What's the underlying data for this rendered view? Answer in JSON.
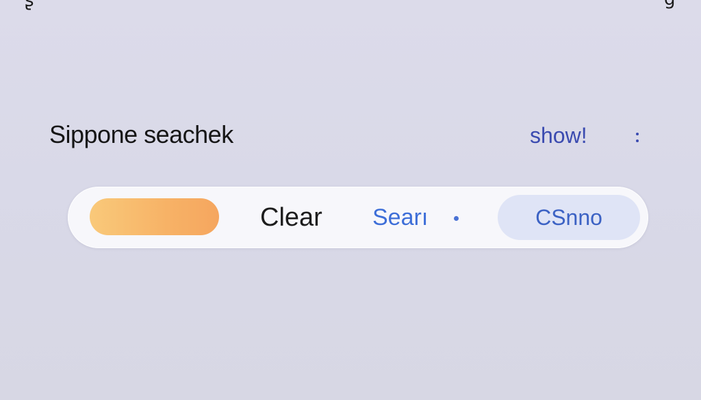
{
  "header": {
    "title": "Sippone seachek",
    "show_link": "show!",
    "more_icon": "more-vertical-icon"
  },
  "top_glyphs": {
    "left": "ʂ",
    "right": "g"
  },
  "search_bar": {
    "pill_icon": "gradient-pill",
    "clear_label": "Clear",
    "search_label": "Searı",
    "status_dot_icon": "dot-icon",
    "action_label": "CSnno"
  },
  "colors": {
    "background": "#dcdbea",
    "accent": "#3b4bb0",
    "pill_gradient_start": "#f9c97a",
    "pill_gradient_end": "#f5a65f",
    "action_bg": "#dfe4f6"
  }
}
